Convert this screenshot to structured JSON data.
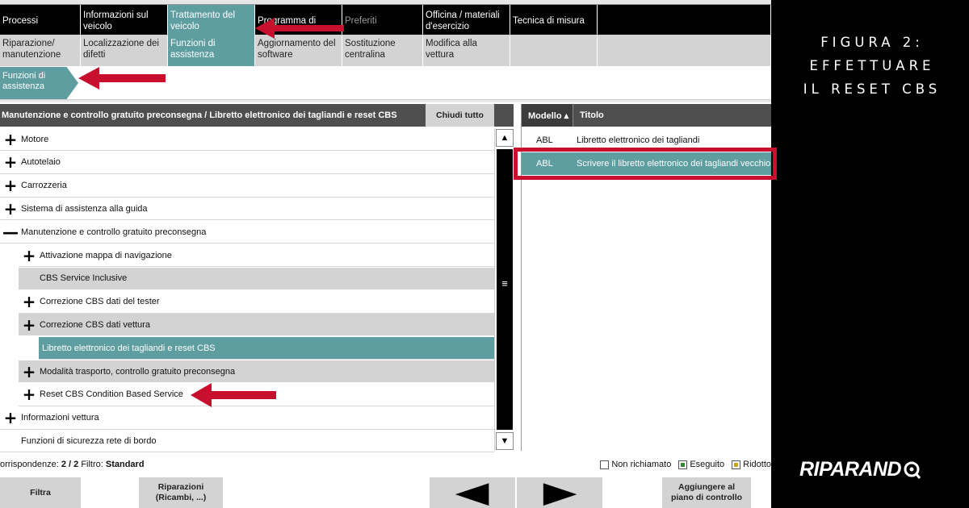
{
  "nav_row1": [
    {
      "label": "Processi",
      "state": "normal"
    },
    {
      "label": "Informazioni sul veicolo",
      "state": "normal"
    },
    {
      "label": "Trattamento del veicolo",
      "state": "active"
    },
    {
      "label": "Programma di",
      "state": "normal"
    },
    {
      "label": "Preferiti",
      "state": "dim"
    },
    {
      "label": "Officina / materiali d'esercizio",
      "state": "normal"
    },
    {
      "label": "Tecnica di misura",
      "state": "normal"
    },
    {
      "label": "",
      "state": "normal"
    }
  ],
  "nav_row2": [
    {
      "label": "Riparazione/ manutenzione",
      "state": "normal"
    },
    {
      "label": "Localizzazione dei difetti",
      "state": "normal"
    },
    {
      "label": "Funzioni di assistenza",
      "state": "active"
    },
    {
      "label": "Aggiornamento del software",
      "state": "normal"
    },
    {
      "label": "Sostituzione centralina",
      "state": "normal"
    },
    {
      "label": "Modifica alla vettura",
      "state": "normal"
    },
    {
      "label": "",
      "state": "normal"
    },
    {
      "label": "",
      "state": "normal"
    }
  ],
  "breadcrumb_tab": "Funzioni di assistenza",
  "left_panel": {
    "header": "Manutenzione e controllo gratuito preconsegna / Libretto elettronico dei tagliandi e reset CBS",
    "close_all": "Chiudi tutto",
    "rows": [
      {
        "label": "Motore",
        "icon": "+",
        "level": 0,
        "style": "plain"
      },
      {
        "label": "Autotelaio",
        "icon": "+",
        "level": 0,
        "style": "plain"
      },
      {
        "label": "Carrozzeria",
        "icon": "+",
        "level": 0,
        "style": "plain"
      },
      {
        "label": "Sistema di assistenza alla guida",
        "icon": "+",
        "level": 0,
        "style": "plain"
      },
      {
        "label": "Manutenzione e controllo gratuito preconsegna",
        "icon": "—",
        "level": 0,
        "style": "plain"
      },
      {
        "label": "Attivazione mappa di navigazione",
        "icon": "+",
        "level": 1,
        "style": "plain"
      },
      {
        "label": "CBS Service Inclusive",
        "icon": "",
        "level": 1,
        "style": "grey"
      },
      {
        "label": "Correzione CBS dati del tester",
        "icon": "+",
        "level": 1,
        "style": "plain"
      },
      {
        "label": "Correzione CBS dati vettura",
        "icon": "+",
        "level": 1,
        "style": "grey"
      },
      {
        "label": "Libretto elettronico dei tagliandi e reset CBS",
        "icon": "",
        "level": 2,
        "style": "selected"
      },
      {
        "label": "Modalità trasporto, controllo gratuito preconsegna",
        "icon": "+",
        "level": 1,
        "style": "grey"
      },
      {
        "label": "Reset CBS Condition Based Service",
        "icon": "+",
        "level": 1,
        "style": "plain"
      },
      {
        "label": "Informazioni vettura",
        "icon": "+",
        "level": 0,
        "style": "plain"
      },
      {
        "label": "Funzioni di sicurezza rete di bordo",
        "icon": "",
        "level": 0,
        "style": "plain"
      }
    ]
  },
  "right_panel": {
    "col_model": "Modello ▴",
    "col_title": "Titolo",
    "rows": [
      {
        "model": "ABL",
        "title": "Libretto elettronico dei tagliandi",
        "selected": false
      },
      {
        "model": "ABL",
        "title": "Scrivere il libretto elettronico dei tagliandi vecchio",
        "selected": true
      }
    ]
  },
  "status": {
    "matches_label": "orrispondenze:",
    "matches_value": "2 / 2",
    "filter_label": "Filtro:",
    "filter_value": "Standard",
    "legend": [
      {
        "label": "Non richiamato",
        "color": "#ffffff"
      },
      {
        "label": "Eseguito",
        "color": "#2e8b2e"
      },
      {
        "label": "Ridotto",
        "color": "#d4a017"
      }
    ]
  },
  "bottom_buttons": {
    "filter": "Filtra",
    "repairs": "Riparazioni (Ricambi, ...)",
    "back_icon": "◀",
    "forward_icon": "▶",
    "add_plan": "Aggiungere al piano di controllo"
  },
  "caption": {
    "line1": "FIGURA 2:",
    "line2": "EFFETTUARE",
    "line3": "IL RESET CBS"
  },
  "logo": "RIPARAND",
  "colors": {
    "accent_teal": "#5f9ea0",
    "annotation_red": "#c8102e",
    "header_dark": "#4f4f4f"
  }
}
